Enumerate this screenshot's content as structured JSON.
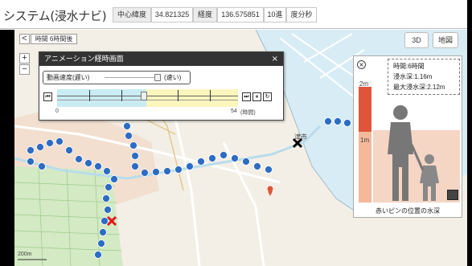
{
  "header": {
    "app_title": "システム(浸水ナビ)",
    "center_lat_label": "中心緯度",
    "center_lat_value": "34.821325",
    "lon_label": "経度",
    "lon_value": "136.575851",
    "deg_label": "10進",
    "dms_label": "度分秒"
  },
  "map_controls": {
    "back_label": "<",
    "time_label": "時間 6時間後",
    "zoom_in": "+",
    "zoom_out": "−",
    "view_3d": "3D",
    "view_label": "地図"
  },
  "animation_dialog": {
    "title": "アニメーション経時画面",
    "close": "×",
    "speed_label": "動画速度(遅い)",
    "speed_fast": "(速い)",
    "start_value": "0",
    "end_value": "54",
    "end_unit": "(時間)",
    "current_fraction": 0.48
  },
  "depth_panel": {
    "close": "×",
    "time_line": "時間:6時間",
    "depth_line": "浸水深:1.16m",
    "max_depth_line": "最大浸水深:2.12m",
    "scale_2m": "2m",
    "scale_1m": "1m",
    "caption": "赤いピンの位置の水深"
  },
  "map_labels": {
    "sea_label": "津市",
    "scale_label": "200m"
  },
  "colors": {
    "water_high": "#e0553a",
    "water_low": "#f5b89a",
    "timeline_cyan": "#c9ecf3",
    "timeline_yellow": "#fbf6bd",
    "route_blue": "#2c6cc4"
  }
}
